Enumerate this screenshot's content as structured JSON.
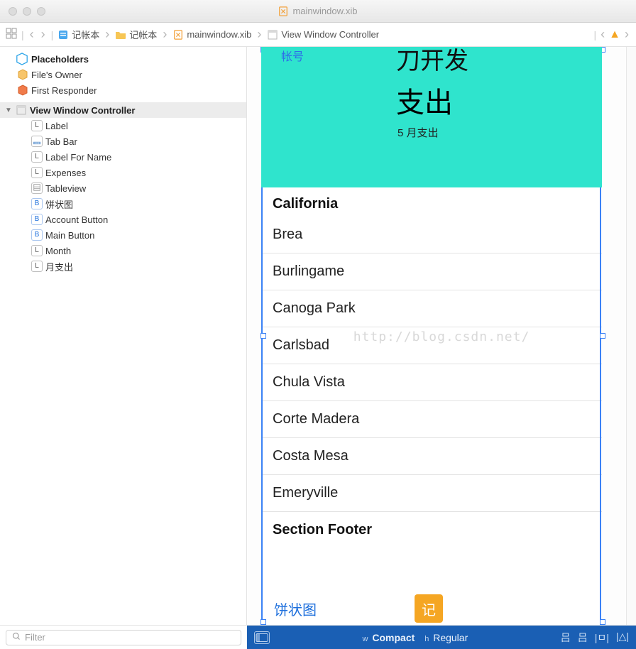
{
  "window": {
    "title": "mainwindow.xib"
  },
  "breadcrumb": {
    "items": [
      {
        "label": "记帐本",
        "icon": "project-icon"
      },
      {
        "label": "记帐本",
        "icon": "folder-icon"
      },
      {
        "label": "mainwindow.xib",
        "icon": "xib-icon"
      },
      {
        "label": "View Window Controller",
        "icon": "viewcontroller-icon"
      }
    ]
  },
  "outline": {
    "placeholders_title": "Placeholders",
    "files_owner": "File's Owner",
    "first_responder": "First Responder",
    "vc_title": "View Window Controller",
    "items": [
      {
        "badge": "L",
        "label": "Label"
      },
      {
        "badge": "T",
        "label": "Tab Bar"
      },
      {
        "badge": "L",
        "label": "Label For Name"
      },
      {
        "badge": "L",
        "label": "Expenses"
      },
      {
        "badge": "V",
        "label": "Tableview"
      },
      {
        "badge": "B",
        "label": "饼状图"
      },
      {
        "badge": "B",
        "label": "Account Button"
      },
      {
        "badge": "B",
        "label": "Main Button"
      },
      {
        "badge": "L",
        "label": "Month"
      },
      {
        "badge": "L",
        "label": "月支出"
      }
    ]
  },
  "device": {
    "link_label": "帐号",
    "heading1": "刀开发",
    "heading2": "支出",
    "subtitle_num": "5",
    "subtitle_text": "  月支出",
    "table": {
      "header": "California",
      "rows": [
        "Brea",
        "Burlingame",
        "Canoga Park",
        "Carlsbad",
        "Chula Vista",
        "Corte Madera",
        "Costa Mesa",
        "Emeryville"
      ],
      "footer": "Section Footer"
    },
    "pie_button": "饼状图",
    "record_button": "记"
  },
  "sizeclass": {
    "w_label": "w",
    "w_value": "Compact",
    "h_label": "h",
    "h_value": "Regular"
  },
  "filter_placeholder": "Filter",
  "watermark": "http://blog.csdn.net/"
}
